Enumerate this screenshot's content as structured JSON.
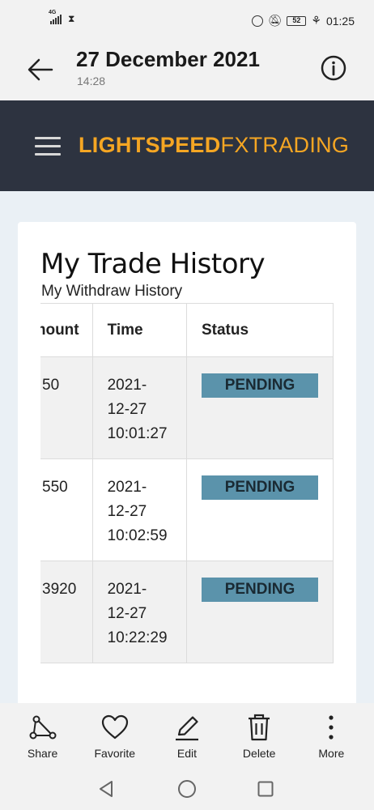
{
  "status_bar": {
    "network": "4G",
    "time": "01:25",
    "battery": "52"
  },
  "viewer": {
    "title": "27 December 2021",
    "subtitle": "14:28"
  },
  "site": {
    "brand_bold": "LIGHTSPEED",
    "brand_light": "FXTRADING"
  },
  "page": {
    "title": "My Trade History",
    "subtitle": "My Withdraw History"
  },
  "table": {
    "headers": {
      "amount": "mount",
      "time": "Time",
      "status": "Status"
    },
    "rows": [
      {
        "amount": "50",
        "time_date_y": "2021-",
        "time_date_md": "12-27",
        "time_clock": "10:01:27",
        "status": "PENDING"
      },
      {
        "amount": "550",
        "time_date_y": "2021-",
        "time_date_md": "12-27",
        "time_clock": "10:02:59",
        "status": "PENDING"
      },
      {
        "amount": "3920",
        "time_date_y": "2021-",
        "time_date_md": "12-27",
        "time_clock": "10:22:29",
        "status": "PENDING"
      }
    ]
  },
  "actions": {
    "share": "Share",
    "favorite": "Favorite",
    "edit": "Edit",
    "delete": "Delete",
    "more": "More"
  },
  "colors": {
    "header_bg": "#2d3340",
    "brand": "#f5a623",
    "badge": "#5b93ab",
    "page_bg": "#eaf0f5"
  }
}
